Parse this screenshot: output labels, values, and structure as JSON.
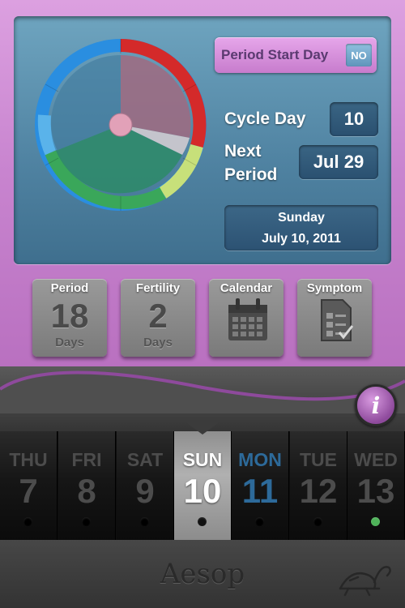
{
  "header": {
    "period_start_label": "Period Start Day",
    "period_start_toggle": "NO"
  },
  "cycle": {
    "cycle_day_label": "Cycle Day",
    "cycle_day_value": "10",
    "next_label_1": "Next",
    "next_label_2": "Period",
    "next_period_value": "Jul 29",
    "date_weekday": "Sunday",
    "date_full": "July 10, 2011"
  },
  "tiles": [
    {
      "title": "Period",
      "number": "18",
      "unit": "Days"
    },
    {
      "title": "Fertility",
      "number": "2",
      "unit": "Days"
    },
    {
      "title": "Calendar",
      "icon": "calendar-icon"
    },
    {
      "title": "Symptom",
      "icon": "symptom-form-icon"
    }
  ],
  "info_button": "i",
  "days": [
    {
      "name": "THU",
      "num": "7"
    },
    {
      "name": "FRI",
      "num": "8"
    },
    {
      "name": "SAT",
      "num": "9"
    },
    {
      "name": "SUN",
      "num": "10"
    },
    {
      "name": "MON",
      "num": "11"
    },
    {
      "name": "TUE",
      "num": "12"
    },
    {
      "name": "WED",
      "num": "13"
    }
  ],
  "footer": {
    "brand": "Aesop",
    "logo_icon": "turtle-icon"
  },
  "colors": {
    "frame": "#c884cf",
    "panel": "#4f82a1",
    "period_arc": "#d42a2a",
    "fertile_arc": "#3aa75a",
    "safe_arc": "#2a8ee0",
    "today_blue": "#2d6a9a",
    "fertile_dot": "#4fb35a"
  }
}
